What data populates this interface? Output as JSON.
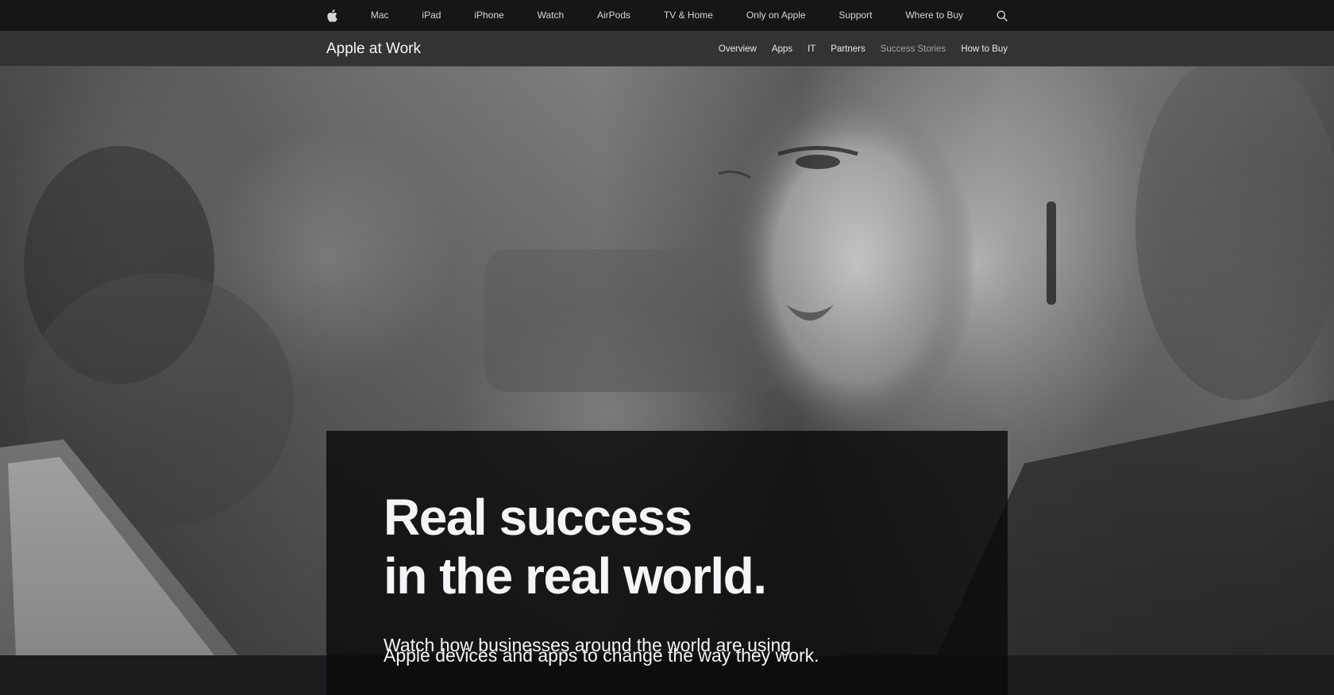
{
  "globalnav": {
    "apple_icon": "apple-logo-icon",
    "items": [
      {
        "label": "Mac"
      },
      {
        "label": "iPad"
      },
      {
        "label": "iPhone"
      },
      {
        "label": "Watch"
      },
      {
        "label": "AirPods"
      },
      {
        "label": "TV & Home"
      },
      {
        "label": "Only on Apple"
      },
      {
        "label": "Support"
      },
      {
        "label": "Where to Buy"
      }
    ],
    "search_icon": "search-icon"
  },
  "localnav": {
    "title": "Apple at Work",
    "items": [
      {
        "label": "Overview"
      },
      {
        "label": "Apps"
      },
      {
        "label": "IT"
      },
      {
        "label": "Partners"
      },
      {
        "label": "Success Stories",
        "current": true
      },
      {
        "label": "How to Buy"
      }
    ]
  },
  "hero": {
    "headline_line1": "Real success",
    "headline_line2": "in the real world.",
    "subhead_line1": "Watch how businesses around the world are using",
    "subhead_line2": "Apple devices and apps to change the way they work."
  },
  "colors": {
    "globalnav_bg": "#161617",
    "localnav_bg": "#333336",
    "panel_bg": "#0a0a0a",
    "text": "#f5f5f7",
    "current_link": "#a1a1a6"
  }
}
